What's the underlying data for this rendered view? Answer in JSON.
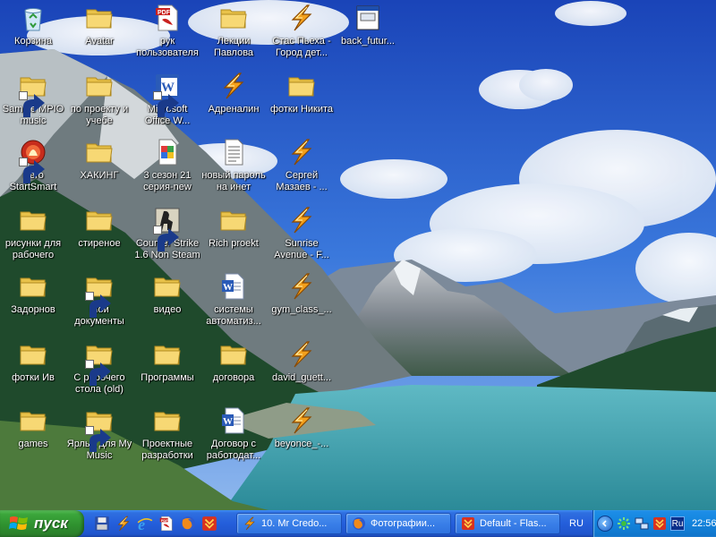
{
  "colors": {
    "sky_top": "#1f4fbf",
    "sky_mid": "#3f7fe0",
    "lake": "#3fa6b0",
    "forest": "#1e4a2a",
    "taskbar": "#245edb",
    "start_green": "#3ba63b",
    "tray_blue": "#1486df"
  },
  "desktop": {
    "icons": [
      {
        "label": "Корзина",
        "icon": "recycle-bin-icon",
        "shortcut": false
      },
      {
        "label": "Avatar",
        "icon": "folder-icon",
        "shortcut": false
      },
      {
        "label": "рук пользователя",
        "icon": "pdf-icon",
        "shortcut": false
      },
      {
        "label": "Лекции Павлова",
        "icon": "folder-icon",
        "shortcut": false
      },
      {
        "label": "Стас Пьеха - Город дет...",
        "icon": "winamp-icon",
        "shortcut": false
      },
      {
        "label": "back_futur...",
        "icon": "file-window-icon",
        "shortcut": false
      },
      {
        "label": "Sample MPIO music",
        "icon": "folder-icon",
        "shortcut": true
      },
      {
        "label": "по проекту и учебе",
        "icon": "folder-icon",
        "shortcut": false
      },
      {
        "label": "Microsoft Office W...",
        "icon": "word-app-icon",
        "shortcut": true
      },
      {
        "label": "Адреналин",
        "icon": "winamp-icon",
        "shortcut": false
      },
      {
        "label": "фотки Никита",
        "icon": "folder-icon",
        "shortcut": false
      },
      {
        "label": "Nero StartSmart",
        "icon": "nero-icon",
        "shortcut": true
      },
      {
        "label": "ХАКИНГ",
        "icon": "folder-icon",
        "shortcut": false
      },
      {
        "label": "3 сезон 21 серия-new",
        "icon": "image-file-icon",
        "shortcut": false
      },
      {
        "label": "новый пароль на инет",
        "icon": "text-file-icon",
        "shortcut": false
      },
      {
        "label": "Сергей Мазаев - ...",
        "icon": "winamp-icon",
        "shortcut": false
      },
      {
        "label": "рисунки для рабочего",
        "icon": "folder-icon",
        "shortcut": false
      },
      {
        "label": "стиреное",
        "icon": "folder-icon",
        "shortcut": false
      },
      {
        "label": "Counter Strike 1.6 Non Steam",
        "icon": "counter-strike-icon",
        "shortcut": true
      },
      {
        "label": "Rich proekt",
        "icon": "folder-icon",
        "shortcut": false
      },
      {
        "label": "Sunrise Avenue - F...",
        "icon": "winamp-icon",
        "shortcut": false
      },
      {
        "label": "Задорнов",
        "icon": "folder-icon",
        "shortcut": false
      },
      {
        "label": "Мои документы",
        "icon": "folder-icon",
        "shortcut": true
      },
      {
        "label": "видео",
        "icon": "folder-icon",
        "shortcut": false
      },
      {
        "label": "системы автоматиз...",
        "icon": "word-doc-icon",
        "shortcut": false
      },
      {
        "label": "gym_class_...",
        "icon": "winamp-icon",
        "shortcut": false
      },
      {
        "label": "фотки Ив",
        "icon": "folder-icon",
        "shortcut": false
      },
      {
        "label": "С рабочего стола (old)",
        "icon": "folder-icon",
        "shortcut": true
      },
      {
        "label": "Программы",
        "icon": "folder-icon",
        "shortcut": false
      },
      {
        "label": "договора",
        "icon": "folder-icon",
        "shortcut": false
      },
      {
        "label": "david_guett...",
        "icon": "winamp-icon",
        "shortcut": false
      },
      {
        "label": "games",
        "icon": "folder-icon",
        "shortcut": false
      },
      {
        "label": "Ярлык для My Music",
        "icon": "folder-icon",
        "shortcut": true
      },
      {
        "label": "Проектные разработки",
        "icon": "folder-icon",
        "shortcut": false
      },
      {
        "label": "Договор с работодат...",
        "icon": "word-doc-icon",
        "shortcut": false
      },
      {
        "label": "beyonce_-...",
        "icon": "winamp-icon",
        "shortcut": false
      }
    ]
  },
  "taskbar": {
    "start_label": "пуск",
    "quick_launch": [
      {
        "icon": "save-disk-icon"
      },
      {
        "icon": "winamp-icon"
      },
      {
        "icon": "internet-explorer-icon"
      },
      {
        "icon": "pdf-icon"
      },
      {
        "icon": "firefox-icon"
      },
      {
        "icon": "download-master-icon"
      }
    ],
    "tasks": [
      {
        "label": "10. Mr Credo...",
        "icon": "winamp-icon"
      },
      {
        "label": "Фотографии...",
        "icon": "firefox-icon"
      },
      {
        "label": "Default - Flas...",
        "icon": "download-master-icon"
      }
    ],
    "language": "RU",
    "tray": {
      "ru_badge": "Ru",
      "clock": "22:56"
    }
  }
}
